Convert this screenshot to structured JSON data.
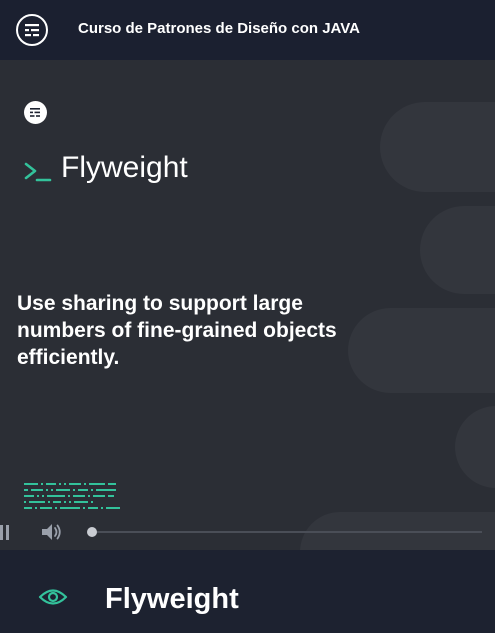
{
  "header": {
    "title": "Curso de Patrones de Diseño con JAVA",
    "menu_icon": "course-menu-icon"
  },
  "slide": {
    "logo_icon": "platzi-logo-icon",
    "prompt_icon": "terminal-prompt-icon",
    "title": "Flyweight",
    "body": "Use sharing to support large numbers of fine-grained objects efficiently."
  },
  "player": {
    "progress": 0.0,
    "pause_icon": "pause-icon",
    "volume_icon": "volume-icon"
  },
  "footer": {
    "title": "Flyweight",
    "eye_icon": "eye-icon"
  },
  "colors": {
    "header_bg": "#1b2030",
    "video_bg": "#2b2e35",
    "accent_green": "#33c29b",
    "text": "#ffffff"
  }
}
